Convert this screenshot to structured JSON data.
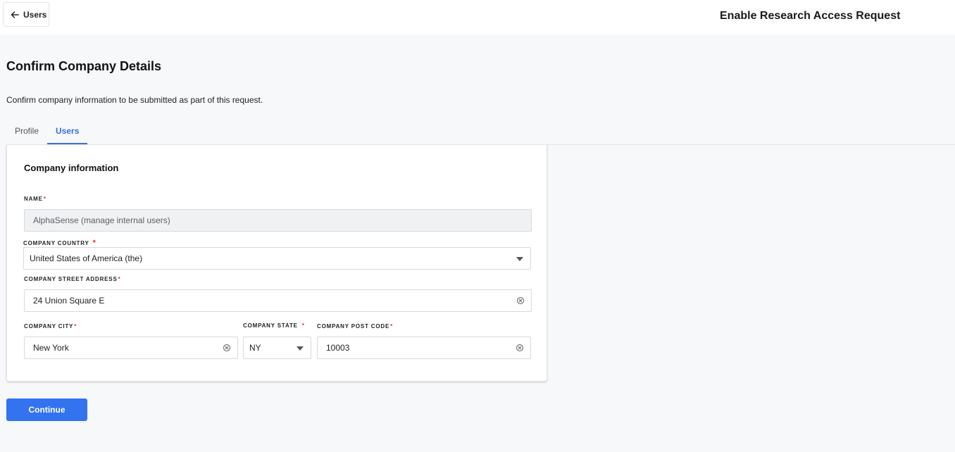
{
  "header": {
    "back_label": "Users",
    "title": "Enable Research Access Request"
  },
  "page": {
    "title": "Confirm Company Details",
    "description": "Confirm company information to be submitted as part of this request."
  },
  "tabs": [
    {
      "label": "Profile",
      "active": false
    },
    {
      "label": "Users",
      "active": true
    }
  ],
  "card": {
    "title": "Company information",
    "fields": {
      "name": {
        "label": "NAME",
        "required_mark": "*",
        "value": "AlphaSense (manage internal users)"
      },
      "country": {
        "label": "COMPANY COUNTRY",
        "required_mark": "*",
        "value": "United States of America (the)"
      },
      "street": {
        "label": "COMPANY STREET ADDRESS",
        "required_mark": "*",
        "value": "24 Union Square E"
      },
      "city": {
        "label": "COMPANY CITY",
        "required_mark": "*",
        "value": "New York"
      },
      "state": {
        "label": "COMPANY STATE",
        "required_mark": "*",
        "value": "NY"
      },
      "postcode": {
        "label": "COMPANY POST CODE",
        "required_mark": "*",
        "value": "10003"
      }
    }
  },
  "actions": {
    "continue_label": "Continue"
  },
  "colors": {
    "accent": "#3373f0",
    "tab_active": "#3a6edb",
    "required": "#e03131"
  },
  "icons": {
    "back": "arrow-left-icon",
    "clear": "clear-circle-icon",
    "dropdown": "caret-down-icon"
  }
}
